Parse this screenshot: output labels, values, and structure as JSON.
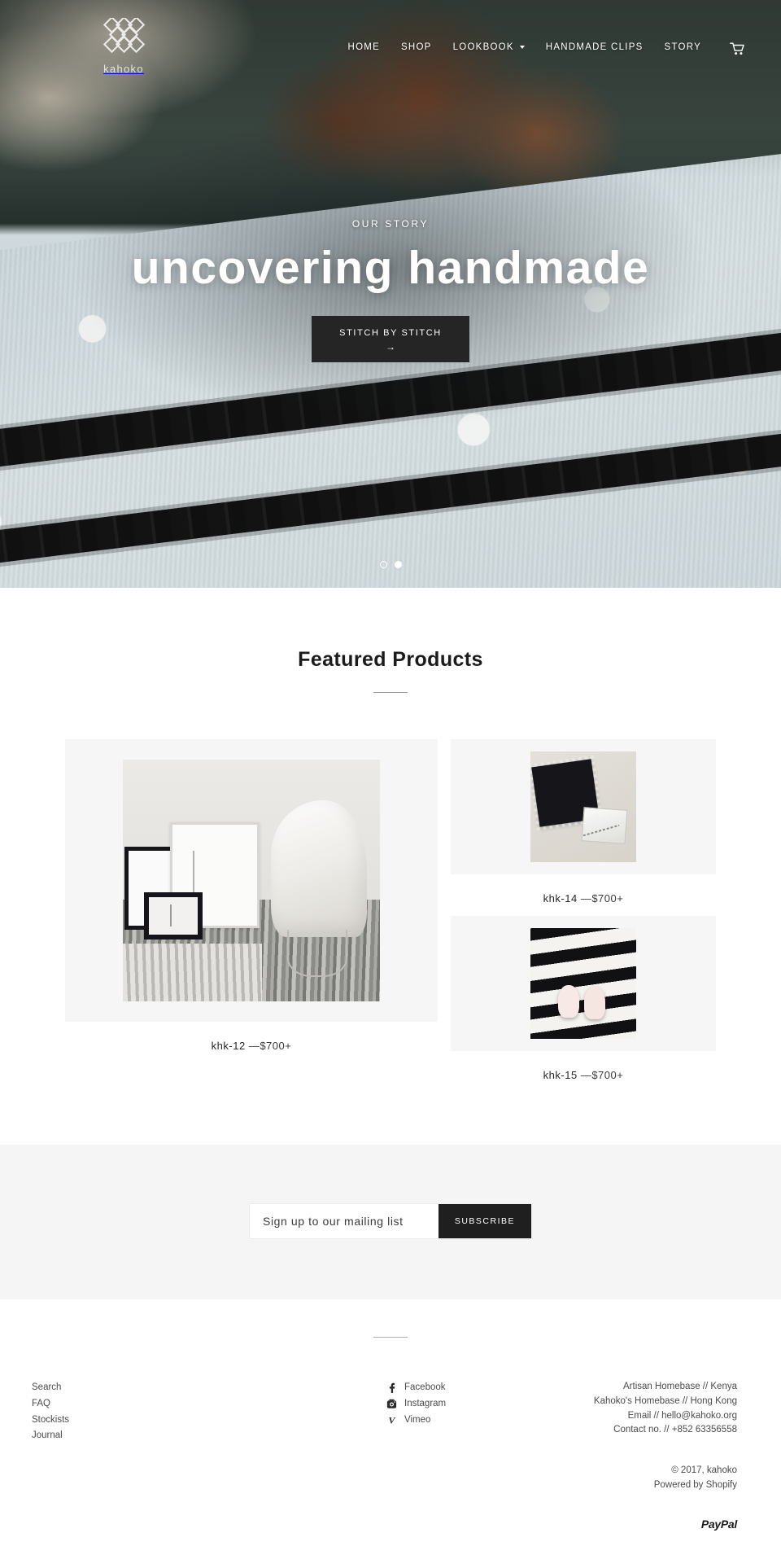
{
  "brand": {
    "name": "kahoko",
    "logo_icon": "diamond-lattice-logo"
  },
  "nav": {
    "items": [
      {
        "label": "HOME",
        "caret": false
      },
      {
        "label": "SHOP",
        "caret": false
      },
      {
        "label": "LOOKBOOK",
        "caret": true
      },
      {
        "label": "HANDMADE CLIPS",
        "caret": false
      },
      {
        "label": "STORY",
        "caret": false
      }
    ],
    "cart_icon": "shopping-cart-icon"
  },
  "hero": {
    "eyebrow": "OUR STORY",
    "title": "uncovering handmade",
    "cta_label": "STITCH BY STITCH",
    "cta_arrow": "→",
    "slides": [
      {
        "active": false
      },
      {
        "active": true
      }
    ]
  },
  "featured": {
    "title": "Featured Products",
    "products": [
      {
        "id": "khk-12",
        "name": "khk-12",
        "price": "—$700+",
        "size": "large"
      },
      {
        "id": "khk-14",
        "name": "khk-14",
        "price": "—$700+",
        "size": "small"
      },
      {
        "id": "khk-15",
        "name": "khk-15",
        "price": "—$700+",
        "size": "small"
      }
    ]
  },
  "newsletter": {
    "placeholder": "Sign up to our mailing list",
    "value": "",
    "button_label": "SUBSCRIBE"
  },
  "footer": {
    "links": [
      {
        "label": "Search"
      },
      {
        "label": "FAQ"
      },
      {
        "label": "Stockists"
      },
      {
        "label": "Journal"
      }
    ],
    "social": [
      {
        "label": "Facebook",
        "icon": "facebook-icon"
      },
      {
        "label": "Instagram",
        "icon": "instagram-icon"
      },
      {
        "label": "Vimeo",
        "icon": "vimeo-icon"
      }
    ],
    "contact": [
      {
        "line": "Artisan Homebase // Kenya"
      },
      {
        "line": "Kahoko's Homebase // Hong Kong"
      },
      {
        "line": "Email // hello@kahoko.org"
      },
      {
        "line": "Contact no. // +852 63356558"
      }
    ],
    "legal": [
      {
        "line": "© 2017, kahoko"
      },
      {
        "line": "Powered by Shopify"
      }
    ],
    "payment": {
      "label": "PayPal",
      "icon": "paypal-logo"
    }
  },
  "colors": {
    "accent_dark": "#1f1f1f",
    "page_bg": "#ffffff",
    "panel_bg": "#f5f5f5",
    "product_bg": "#f6f6f6",
    "text": "#1c1c1c",
    "muted_text": "#4b4b4b"
  }
}
